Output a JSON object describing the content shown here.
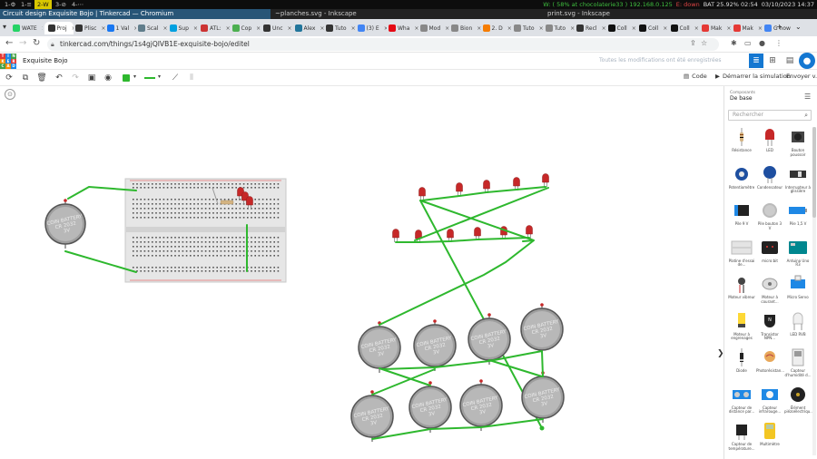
{
  "sysbar": {
    "workspaces": [
      "1-⚙",
      "1-≡",
      "2-W",
      "3-⊘",
      "4-⋯"
    ],
    "active_workspace": 2,
    "status": {
      "wifi": "W: ( 58% at chocolaterie33 ) 192.168.0.125",
      "eth": "E: down",
      "battery": "BAT 25.92% 02:54",
      "datetime": "03/10/2023 14:37"
    }
  },
  "windows": {
    "left": "Circuit design Exquisite Bojo | Tinkercad — Chromium",
    "mid": "~planches.svg - Inkscape",
    "right": "print.svg - Inkscape"
  },
  "tabs": [
    {
      "label": "WATE",
      "color": "#25d366"
    },
    {
      "label": "Proj",
      "color": "#333333"
    },
    {
      "label": "Plisc",
      "color": "#333333"
    },
    {
      "label": "1 Val",
      "color": "#1877f2"
    },
    {
      "label": "Scal",
      "color": "#607d8b"
    },
    {
      "label": "Sup",
      "color": "#00a0e0"
    },
    {
      "label": "ATL:",
      "color": "#cc3333"
    },
    {
      "label": "Cop",
      "color": "#4caf50"
    },
    {
      "label": "Unc",
      "color": "#333333"
    },
    {
      "label": "Alex",
      "color": "#21759b"
    },
    {
      "label": "Tuto",
      "color": "#333333"
    },
    {
      "label": "(3) E",
      "color": "#4285f4"
    },
    {
      "label": "Wha",
      "color": "#e50914"
    },
    {
      "label": "Mod",
      "color": "#888888"
    },
    {
      "label": "Bion",
      "color": "#888888"
    },
    {
      "label": "2. D",
      "color": "#f57c00"
    },
    {
      "label": "Tuto",
      "color": "#888888"
    },
    {
      "label": "Tuto",
      "color": "#888888"
    },
    {
      "label": "Recl",
      "color": "#333333"
    },
    {
      "label": "Coll",
      "color": "#111111"
    },
    {
      "label": "Coll",
      "color": "#111111"
    },
    {
      "label": "Coll",
      "color": "#111111"
    },
    {
      "label": "Mak",
      "color": "#e53935"
    },
    {
      "label": "Mak",
      "color": "#e53935"
    },
    {
      "label": "G how",
      "color": "#4285f4"
    }
  ],
  "address": {
    "url": "tinkercad.com/things/1s4gjQIVB1E-exquisite-bojo/editel"
  },
  "header": {
    "logo_letters": [
      "T",
      "I",
      "N",
      "K",
      "E",
      "R",
      "C",
      "A",
      "D"
    ],
    "logo_colors": [
      "#e53935",
      "#1e88e5",
      "#43a047",
      "#fb8c00",
      "#1e88e5",
      "#e53935",
      "#43a047",
      "#fb8c00",
      "#1e88e5"
    ],
    "project_name": "Exquisite Bojo",
    "saved_message": "Toutes les modifications ont été enregistrées"
  },
  "toolbar": {
    "code_label": "Code",
    "simulate_label": "Démarrer la simulation",
    "send_label": "Envoyer v..."
  },
  "panel": {
    "components_label": "Composants",
    "category": "De base",
    "search_placeholder": "Rechercher",
    "components": [
      {
        "name": "Résistance",
        "icon": "resistor-icon"
      },
      {
        "name": "LED",
        "icon": "led-icon"
      },
      {
        "name": "Bouton poussoir",
        "icon": "pushbutton-icon"
      },
      {
        "name": "Potentiomètre",
        "icon": "potentiometer-icon"
      },
      {
        "name": "Condensateur",
        "icon": "capacitor-icon"
      },
      {
        "name": "Interrupteur à glissière",
        "icon": "slide-switch-icon"
      },
      {
        "name": "Pile 9 V",
        "icon": "battery-9v-icon"
      },
      {
        "name": "Pile bouton 3 V",
        "icon": "coin-battery-icon"
      },
      {
        "name": "Pile 1,5 V",
        "icon": "battery-aa-icon"
      },
      {
        "name": "Platine d'essai de...",
        "icon": "breadboard-icon"
      },
      {
        "name": "micro:bit",
        "icon": "microbit-icon"
      },
      {
        "name": "Arduino Uno R3",
        "icon": "arduino-icon"
      },
      {
        "name": "Moteur vibreur",
        "icon": "vibration-motor-icon"
      },
      {
        "name": "Moteur à courant...",
        "icon": "dc-motor-icon"
      },
      {
        "name": "Micro Servo",
        "icon": "servo-icon"
      },
      {
        "name": "Moteur à engrenages",
        "icon": "gear-motor-icon"
      },
      {
        "name": "Transistor NPN...",
        "icon": "transistor-icon"
      },
      {
        "name": "LED RVB",
        "icon": "rgb-led-icon"
      },
      {
        "name": "Diode",
        "icon": "diode-icon"
      },
      {
        "name": "Photorésistan...",
        "icon": "photoresistor-icon"
      },
      {
        "name": "Capteur d'humidité d...",
        "icon": "humidity-sensor-icon"
      },
      {
        "name": "Capteur de distance par...",
        "icon": "ultrasonic-sensor-icon"
      },
      {
        "name": "Capteur infrarouge...",
        "icon": "pir-sensor-icon"
      },
      {
        "name": "Élément piézoélectriqu...",
        "icon": "piezo-icon"
      },
      {
        "name": "Capteur de température...",
        "icon": "temperature-sensor-icon"
      },
      {
        "name": "Multimètre",
        "icon": "multimeter-icon"
      }
    ]
  },
  "canvas": {
    "battery_label_1": "COIN BATTERY",
    "battery_label_2": "CR 2032",
    "battery_label_3": "3V",
    "colors": {
      "wire": "#2eb82e",
      "led": "#c62828",
      "battery": "#b8b8b8",
      "breadboard": "#e6e6e6",
      "rail_red": "#e53935"
    }
  }
}
